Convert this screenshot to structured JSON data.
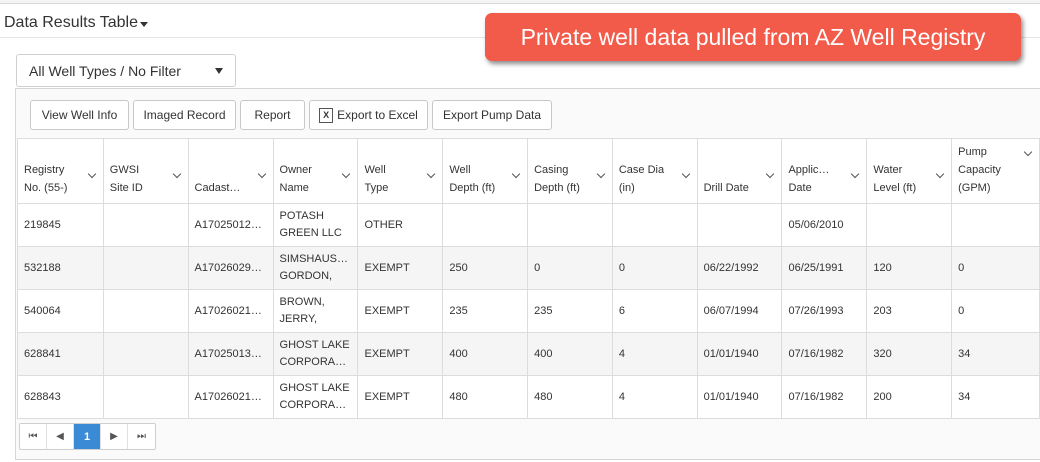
{
  "header": {
    "title": "Data Results Table"
  },
  "callout": {
    "text": "Private well data pulled from AZ Well Registry"
  },
  "filter": {
    "selected": "All Well Types / No Filter"
  },
  "toolbar": {
    "view_well_info": "View Well Info",
    "imaged_record": "Imaged Record",
    "report": "Report",
    "export_excel": "Export to Excel",
    "export_pump": "Export Pump Data"
  },
  "table": {
    "columns": [
      [
        "Registry",
        "No. (55-)"
      ],
      [
        "GWSI",
        "Site ID"
      ],
      [
        "Cadast…"
      ],
      [
        "Owner",
        "Name"
      ],
      [
        "Well",
        "Type"
      ],
      [
        "Well",
        "Depth (ft)"
      ],
      [
        "Casing",
        "Depth (ft)"
      ],
      [
        "Case Dia",
        "(in)"
      ],
      [
        "Drill Date"
      ],
      [
        "Applic…",
        "Date"
      ],
      [
        "Water",
        "Level (ft)"
      ],
      [
        "Pump",
        "Capacity",
        "(GPM)"
      ]
    ],
    "rows": [
      [
        [
          "219845"
        ],
        [
          ""
        ],
        [
          "A17025012…"
        ],
        [
          "POTASH",
          "GREEN LLC"
        ],
        [
          "OTHER"
        ],
        [
          ""
        ],
        [
          ""
        ],
        [
          ""
        ],
        [
          ""
        ],
        [
          "05/06/2010"
        ],
        [
          ""
        ],
        [
          ""
        ]
      ],
      [
        [
          "532188"
        ],
        [
          ""
        ],
        [
          "A17026029…"
        ],
        [
          "SIMSHAUS…",
          "GORDON,"
        ],
        [
          "EXEMPT"
        ],
        [
          "250"
        ],
        [
          "0"
        ],
        [
          "0"
        ],
        [
          "06/22/1992"
        ],
        [
          "06/25/1991"
        ],
        [
          "120"
        ],
        [
          "0"
        ]
      ],
      [
        [
          "540064"
        ],
        [
          ""
        ],
        [
          "A17026021…"
        ],
        [
          "BROWN,",
          "JERRY,"
        ],
        [
          "EXEMPT"
        ],
        [
          "235"
        ],
        [
          "235"
        ],
        [
          "6"
        ],
        [
          "06/07/1994"
        ],
        [
          "07/26/1993"
        ],
        [
          "203"
        ],
        [
          "0"
        ]
      ],
      [
        [
          "628841"
        ],
        [
          ""
        ],
        [
          "A17025013…"
        ],
        [
          "GHOST LAKE",
          "CORPORA…"
        ],
        [
          "EXEMPT"
        ],
        [
          "400"
        ],
        [
          "400"
        ],
        [
          "4"
        ],
        [
          "01/01/1940"
        ],
        [
          "07/16/1982"
        ],
        [
          "320"
        ],
        [
          "34"
        ]
      ],
      [
        [
          "628843"
        ],
        [
          ""
        ],
        [
          "A17026021…"
        ],
        [
          "GHOST LAKE",
          "CORPORA…"
        ],
        [
          "EXEMPT"
        ],
        [
          "480"
        ],
        [
          "480"
        ],
        [
          "4"
        ],
        [
          "01/01/1940"
        ],
        [
          "07/16/1982"
        ],
        [
          "200"
        ],
        [
          "34"
        ]
      ]
    ]
  },
  "pager": {
    "first": "⏮",
    "prev": "◀",
    "current": "1",
    "next": "▶",
    "last": "⏭"
  }
}
